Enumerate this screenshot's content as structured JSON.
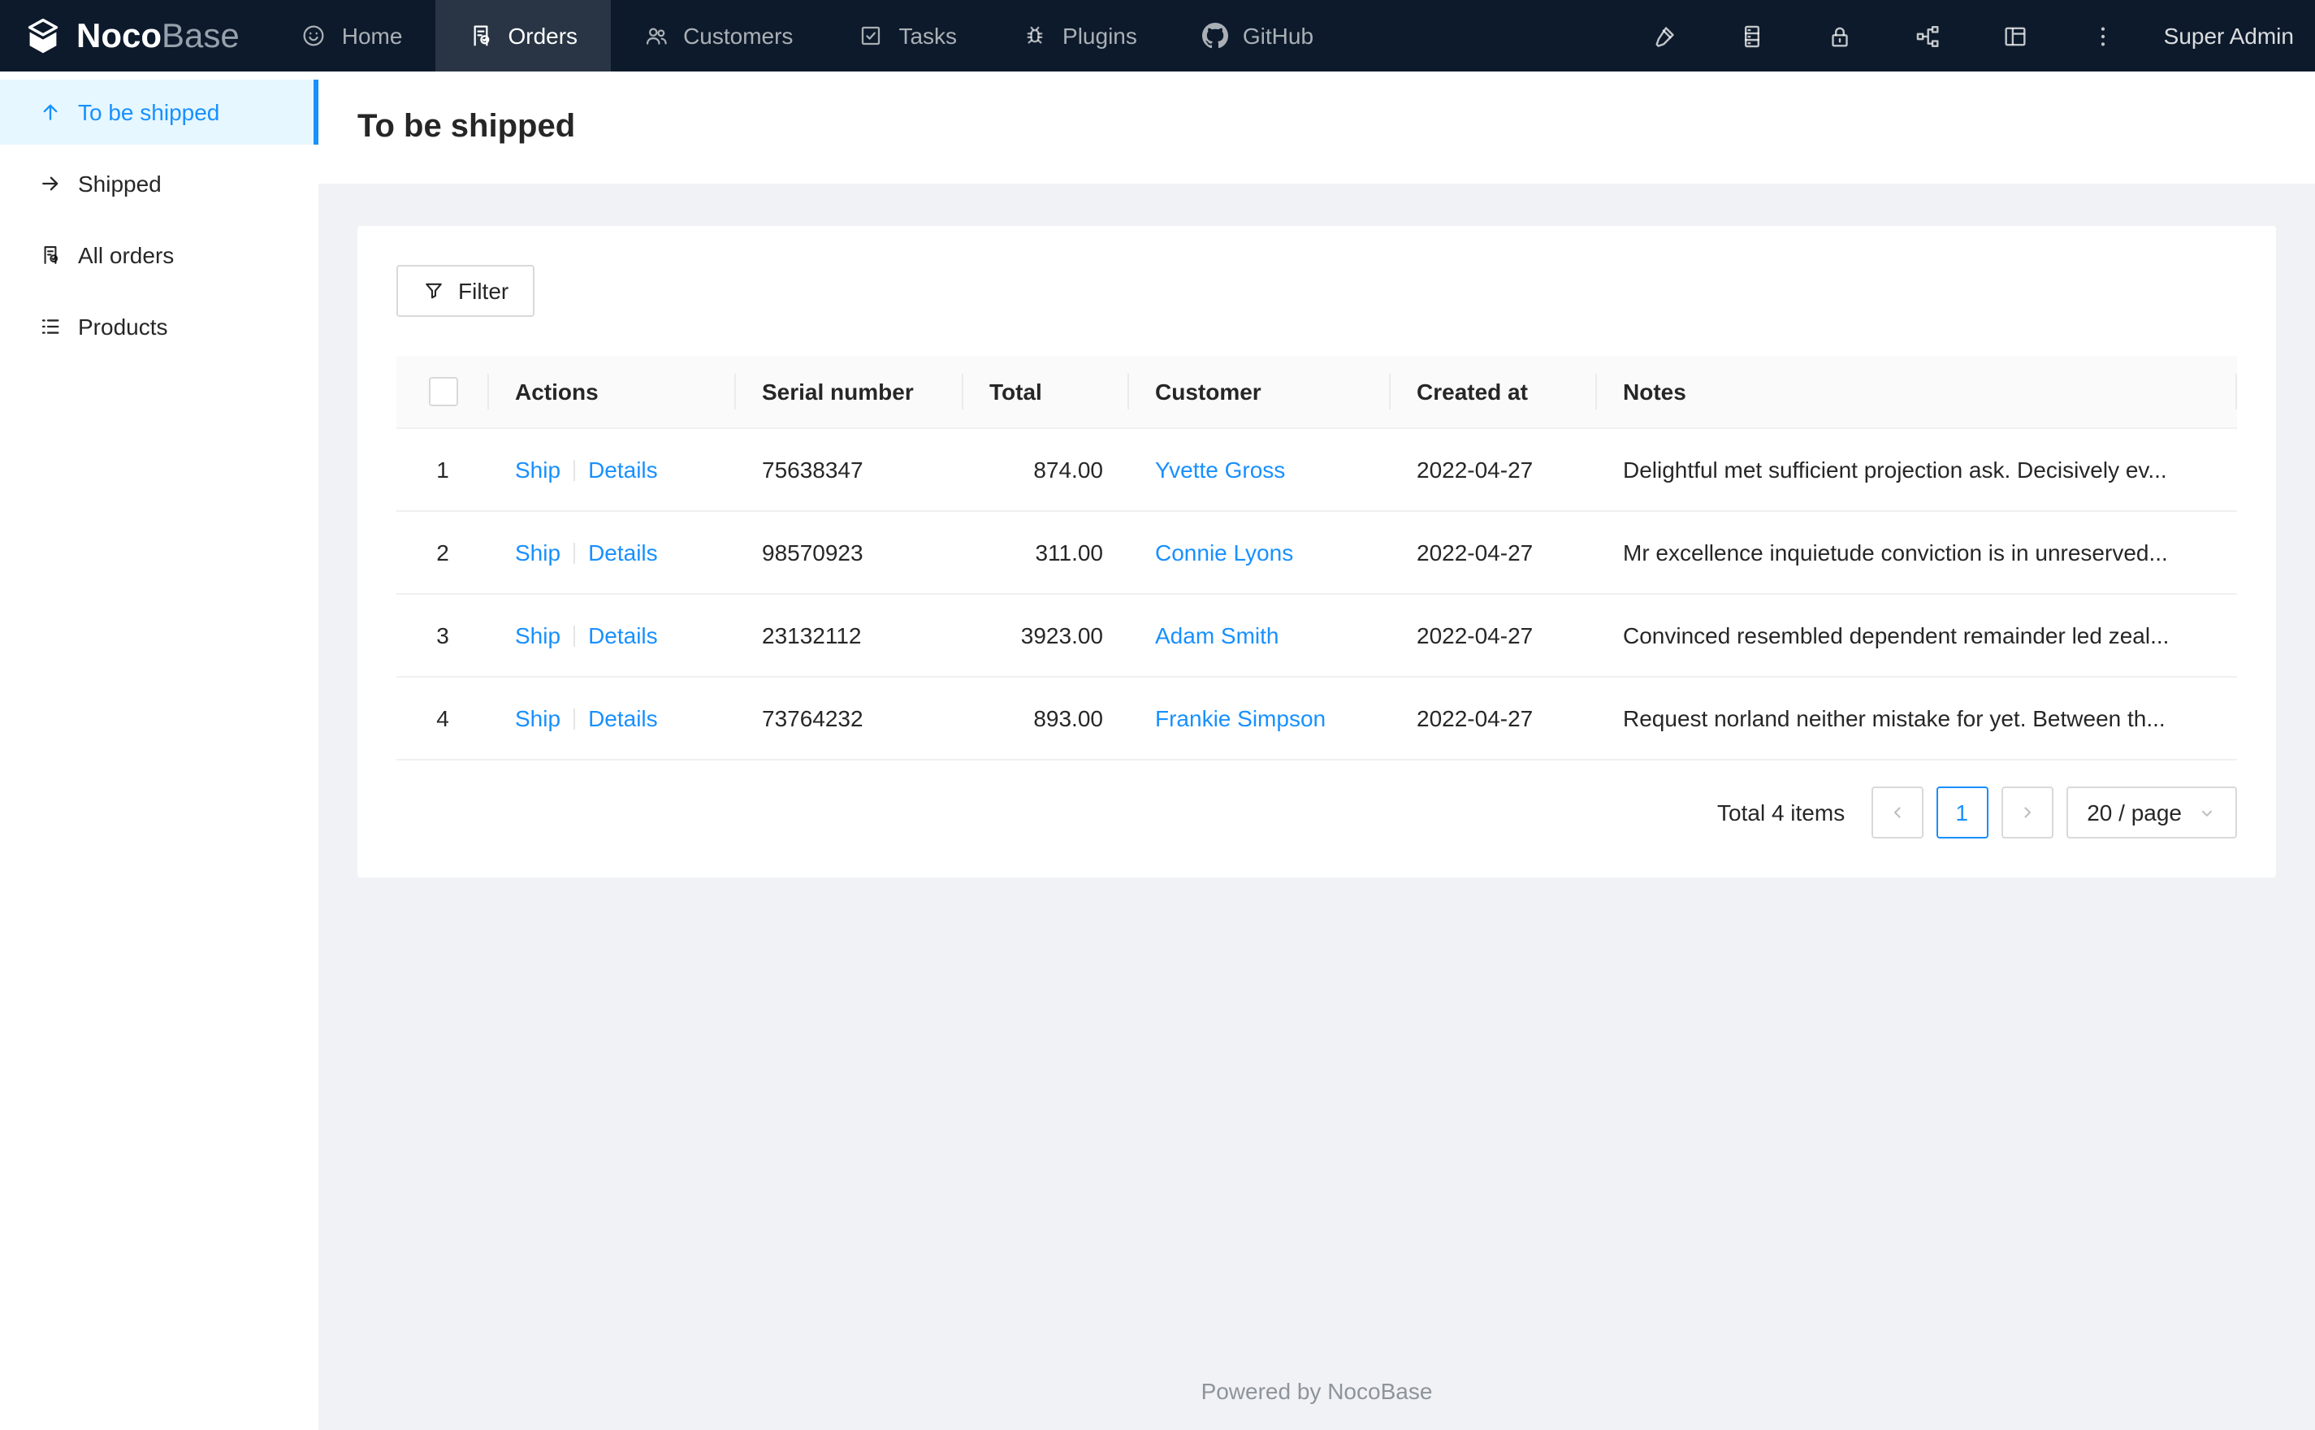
{
  "navbar": {
    "logo": {
      "bold": "Noco",
      "light": "Base",
      "icon": "nocobase-cube-logo"
    },
    "items": [
      {
        "label": "Home",
        "icon": "smile-icon",
        "active": false
      },
      {
        "label": "Orders",
        "icon": "file-done-icon",
        "active": true
      },
      {
        "label": "Customers",
        "icon": "team-icon",
        "active": false
      },
      {
        "label": "Tasks",
        "icon": "check-square-icon",
        "active": false
      },
      {
        "label": "Plugins",
        "icon": "robot-icon",
        "active": false
      },
      {
        "label": "GitHub",
        "icon": "github-icon",
        "active": false
      }
    ],
    "right_icons": [
      "highlighter-icon",
      "database-icon",
      "lock-icon",
      "workflow-nodes-icon",
      "layout-icon",
      "more-vertical-icon"
    ],
    "user": "Super Admin"
  },
  "sidebar": {
    "items": [
      {
        "label": "To be shipped",
        "icon": "arrow-up-icon",
        "active": true
      },
      {
        "label": "Shipped",
        "icon": "arrow-right-icon",
        "active": false
      },
      {
        "label": "All orders",
        "icon": "file-done-icon",
        "active": false
      },
      {
        "label": "Products",
        "icon": "unordered-list-icon",
        "active": false
      }
    ]
  },
  "page": {
    "title": "To be shipped"
  },
  "toolbar": {
    "filter_label": "Filter"
  },
  "table": {
    "columns": [
      "",
      "Actions",
      "Serial number",
      "Total",
      "Customer",
      "Created at",
      "Notes"
    ],
    "action_labels": [
      "Ship",
      "Details"
    ],
    "rows": [
      {
        "index": "1",
        "serial": "75638347",
        "total": "874.00",
        "customer": "Yvette Gross",
        "created_at": "2022-04-27",
        "notes": "Delightful met sufficient projection ask. Decisively ev..."
      },
      {
        "index": "2",
        "serial": "98570923",
        "total": "311.00",
        "customer": "Connie Lyons",
        "created_at": "2022-04-27",
        "notes": "Mr excellence inquietude conviction is in unreserved..."
      },
      {
        "index": "3",
        "serial": "23132112",
        "total": "3923.00",
        "customer": "Adam Smith",
        "created_at": "2022-04-27",
        "notes": "Convinced resembled dependent remainder led zeal..."
      },
      {
        "index": "4",
        "serial": "73764232",
        "total": "893.00",
        "customer": "Frankie Simpson",
        "created_at": "2022-04-27",
        "notes": "Request norland neither mistake for yet. Between th..."
      }
    ]
  },
  "pagination": {
    "total_text": "Total 4 items",
    "current_page": "1",
    "page_size": "20 / page"
  },
  "footer": {
    "text": "Powered by NocoBase"
  },
  "colors": {
    "accent": "#1890ff",
    "navbar_bg": "#0c1a2b",
    "navbar_active_bg": "rgba(255,255,255,0.12)",
    "sidebar_active_bg": "#e6f7ff",
    "content_bg": "#f0f2f5",
    "table_header_bg": "#fafafa",
    "border": "#f0f0f0",
    "control_border": "#d9d9d9"
  }
}
